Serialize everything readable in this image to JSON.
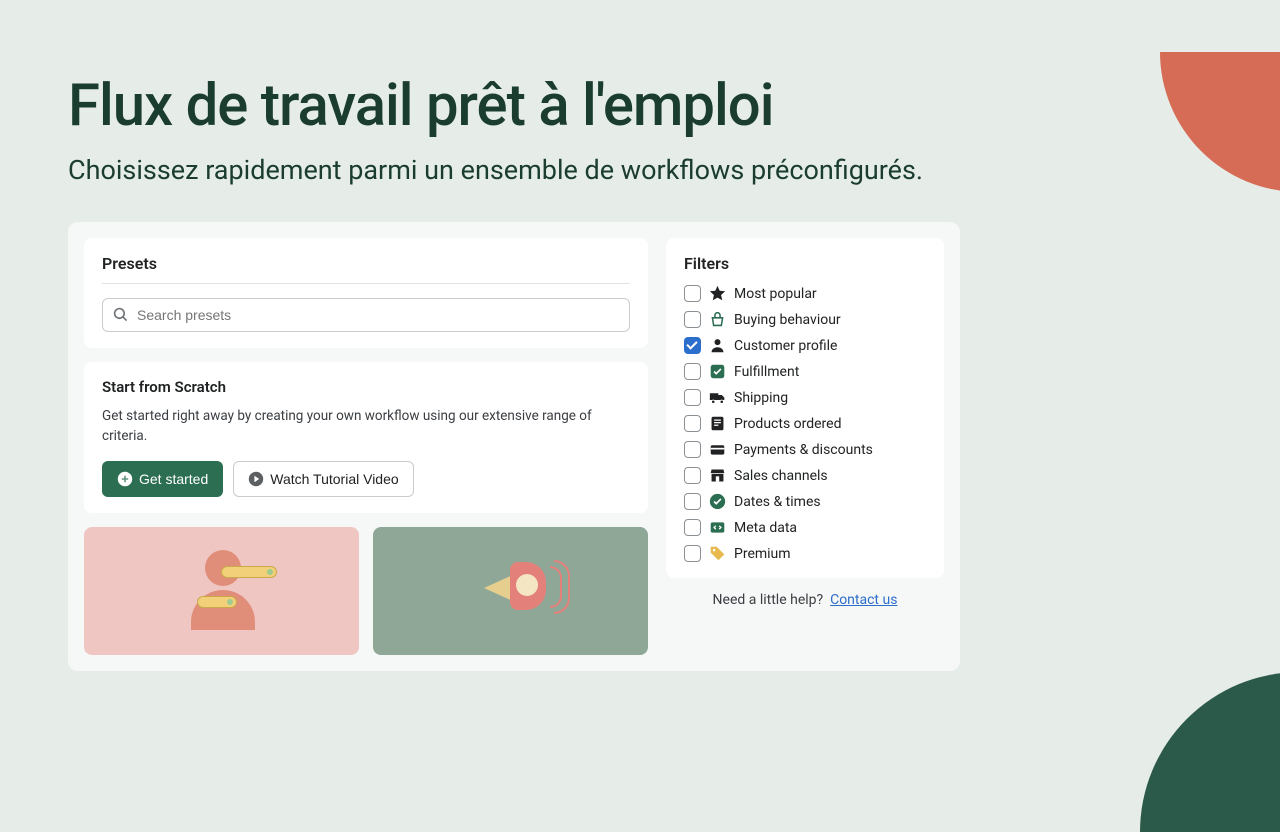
{
  "header": {
    "title": "Flux de travail prêt à l'emploi",
    "subtitle": "Choisissez rapidement parmi un ensemble de workflows préconfigurés."
  },
  "presets": {
    "title": "Presets",
    "search_placeholder": "Search presets"
  },
  "scratch": {
    "title": "Start from Scratch",
    "description": "Get started right away by creating your own workflow using our extensive range of criteria.",
    "get_started_label": "Get started",
    "watch_video_label": "Watch Tutorial Video"
  },
  "filters": {
    "title": "Filters",
    "items": [
      {
        "label": "Most popular",
        "icon": "star",
        "checked": false
      },
      {
        "label": "Buying behaviour",
        "icon": "basket",
        "checked": false
      },
      {
        "label": "Customer profile",
        "icon": "person",
        "checked": true
      },
      {
        "label": "Fulfillment",
        "icon": "checkbox-square",
        "checked": false
      },
      {
        "label": "Shipping",
        "icon": "truck",
        "checked": false
      },
      {
        "label": "Products ordered",
        "icon": "receipt",
        "checked": false
      },
      {
        "label": "Payments & discounts",
        "icon": "card",
        "checked": false
      },
      {
        "label": "Sales channels",
        "icon": "storefront",
        "checked": false
      },
      {
        "label": "Dates & times",
        "icon": "clock-check",
        "checked": false
      },
      {
        "label": "Meta data",
        "icon": "code",
        "checked": false
      },
      {
        "label": "Premium",
        "icon": "tag-gold",
        "checked": false
      }
    ]
  },
  "help": {
    "text": "Need a little help?",
    "link_label": "Contact us"
  }
}
